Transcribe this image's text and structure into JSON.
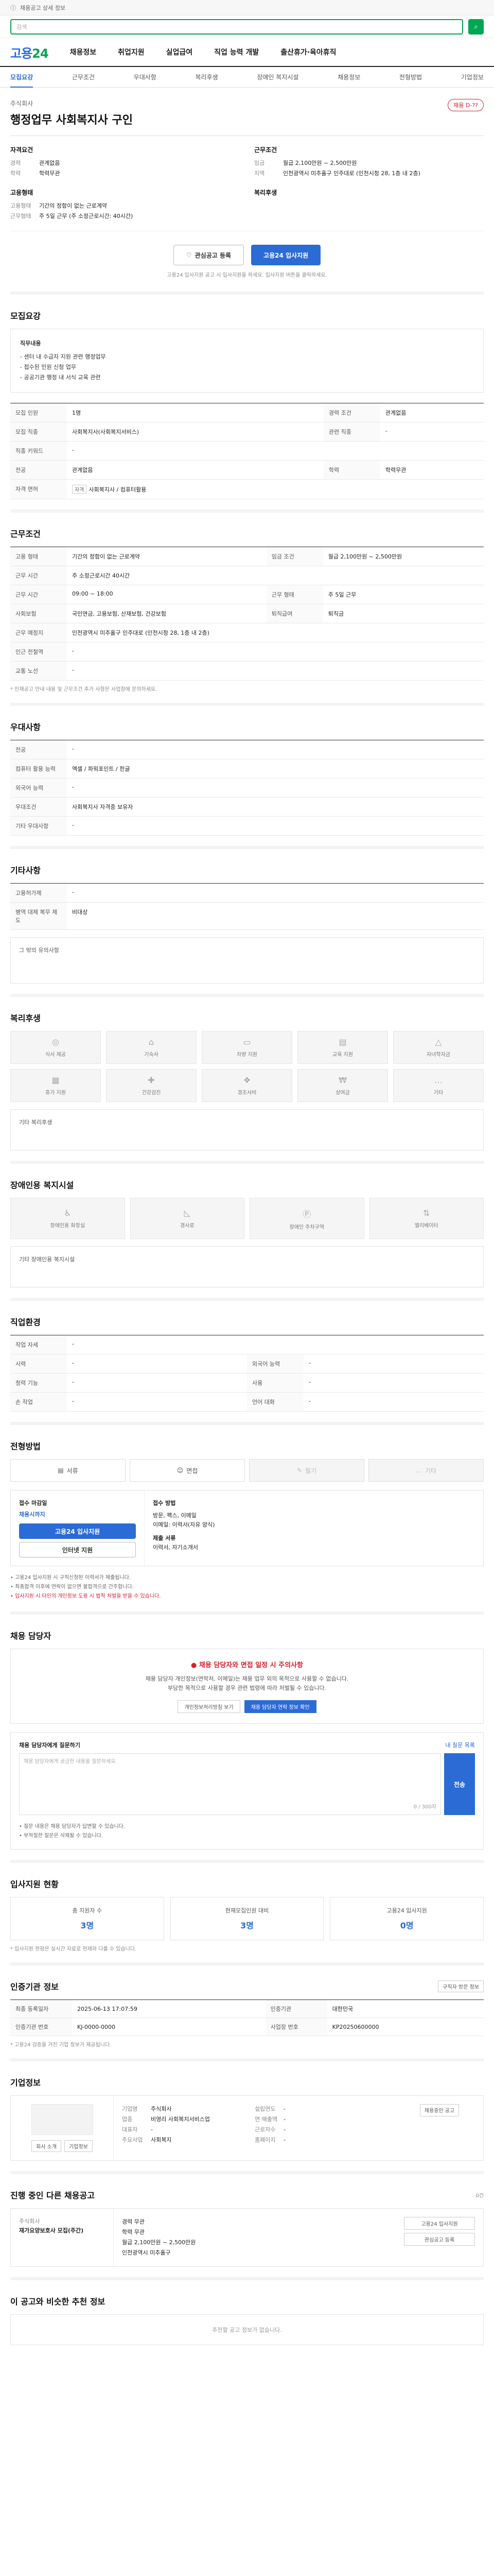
{
  "top": {
    "notice": "채용공고 상세 정보",
    "search_placeholder": "검색"
  },
  "gnb": {
    "logo_a": "고용",
    "logo_b": "24",
    "menu": [
      "채용정보",
      "취업지원",
      "실업급여",
      "직업 능력 개발",
      "출산휴가·육아휴직"
    ]
  },
  "tabs": [
    "모집요강",
    "근무조건",
    "우대사항",
    "복리후생",
    "장애인 복지시설",
    "채용정보",
    "전형방법",
    "기업정보"
  ],
  "head": {
    "company": "주식회사",
    "title": "행정업무 사회복지사 구인",
    "badge": "채용 D-??"
  },
  "summary": {
    "left_title": "자격요건",
    "left": [
      {
        "k": "경력",
        "v": "관계없음"
      },
      {
        "k": "학력",
        "v": "학력무관"
      }
    ],
    "left2_title": "고용형태",
    "left2": [
      {
        "k": "고용형태",
        "v": "기간의 정함이 없는 근로계약"
      },
      {
        "k": "근무형태",
        "v": "주 5일 근무 (주 소정근로시간: 40시간)"
      }
    ],
    "right_title": "근무조건",
    "right": [
      {
        "k": "임금",
        "v": "월급 2,100만원 ~ 2,500만원"
      },
      {
        "k": "지역",
        "v": "인천광역시 미추홀구 인주대로 (인천시청 28, 1층 내 2층)"
      }
    ],
    "right2_title": "복리후생",
    "right2": []
  },
  "actions": {
    "scrap": "관심공고 등록",
    "apply": "고용24 입사지원"
  },
  "note": "고용24 입사지원 공고 시 입사지원을 하세요. 입사지원 버튼을 클릭하세요.",
  "recruit": {
    "title": "모집요강",
    "card_title": "직무내용",
    "card_lines": [
      "- 센터 내 수급자 지원 관련 행정업무",
      "- 접수된 민원 신청 업무",
      "- 공공기관 행정 내 서식 교육 관련"
    ],
    "rows": [
      {
        "k": "모집 인원",
        "v": "1명",
        "k2": "경력 조건",
        "v2": "관계없음"
      },
      {
        "k": "모집 직종",
        "v": "사회복지사(사회복지서비스)",
        "k2": "관련 직종",
        "v2": "-"
      },
      {
        "k": "직종 키워드",
        "v": "-",
        "k2": "",
        "v2": ""
      },
      {
        "k": "전공",
        "v": "관계없음",
        "k2": "학력",
        "v2": "학력무관"
      },
      {
        "k": "자격 면허",
        "v": "사회복지사 / 컴퓨터활용",
        "k2": "",
        "v2": ""
      }
    ]
  },
  "work": {
    "title": "근무조건",
    "rows": [
      {
        "k": "고용 형태",
        "v": "기간의 정함이 없는 근로계약",
        "k2": "임금 조건",
        "v2": "월급 2,100만원 ~ 2,500만원"
      },
      {
        "k": "근무 시간",
        "v": "주 소정근로시간 40시간",
        "k2": "",
        "v2": ""
      },
      {
        "k": "근무 시간",
        "v": "09:00 ~ 18:00",
        "k2": "근무 형태",
        "v2": "주 5일 근무"
      },
      {
        "k": "사회보험",
        "v": "국민연금, 고용보험, 산재보험, 건강보험",
        "k2": "퇴직급여",
        "v2": "퇴직금"
      },
      {
        "k": "근무 예정지",
        "v": "인천광역시 미추홀구 인주대로 (인천시청 28, 1층 내 2층)",
        "k2": "",
        "v2": ""
      },
      {
        "k": "인근 전철역",
        "v": "-",
        "k2": "",
        "v2": ""
      },
      {
        "k": "교통 노선",
        "v": "-",
        "k2": "",
        "v2": ""
      }
    ],
    "note": "* 인재공고 안내 내용 및 근무조건 추가 사항은 사업장에 문의하세요."
  },
  "prefer": {
    "title": "우대사항",
    "rows": [
      {
        "k": "전공",
        "v": "-"
      },
      {
        "k": "컴퓨터 활용 능력",
        "v": "엑셀 / 파워포인트 / 한글"
      },
      {
        "k": "외국어 능력",
        "v": "-"
      },
      {
        "k": "우대조건",
        "v": "사회복지사 자격증 보유자"
      },
      {
        "k": "기타 우대사항",
        "v": "-"
      }
    ]
  },
  "etc": {
    "title": "기타사항",
    "rows": [
      {
        "k": "고용허가제",
        "v": "-"
      },
      {
        "k": "병역 대체 복무 제도",
        "v": "비대상"
      }
    ],
    "box": "그 밖의 유의사항"
  },
  "welfare": {
    "title": "복리후생",
    "tiles": [
      "식사 제공",
      "기숙사",
      "차량 지원",
      "교육 지원",
      "자녀학자금",
      "휴가 지원",
      "건강검진",
      "경조사비",
      "상여금",
      "기타"
    ],
    "box": "기타 복리후생"
  },
  "disab": {
    "title": "장애인용 복지시설",
    "tiles": [
      "장애인용 화장실",
      "경사로",
      "장애인 주차구역",
      "엘리베이터"
    ],
    "box": "기타 장애인용 복지시설"
  },
  "job": {
    "title": "직업환경",
    "rows": [
      {
        "k": "작업 자세",
        "v": "-",
        "k2": "",
        "v2": ""
      },
      {
        "k": "시력",
        "v": "-",
        "k2": "외국어 능력",
        "v2": "-"
      },
      {
        "k": "청력 기능",
        "v": "-",
        "k2": "사용",
        "v2": "-"
      },
      {
        "k": "손 작업",
        "v": "-",
        "k2": "언어 대화",
        "v2": "-"
      }
    ]
  },
  "process": {
    "title": "전형방법",
    "steps": [
      "서류",
      "면접",
      "필기",
      "기타"
    ],
    "left_title": "접수 마감일",
    "left_date": "채용시까지",
    "left_btn": "고용24 입사지원",
    "left_btn2": "인터넷 지원",
    "right_title": "접수 방법",
    "right_lines": [
      "방문, 팩스, 이메일",
      "이메일: 이력서(자유 양식)",
      "제출 서류",
      "이력서, 자기소개서"
    ],
    "bullets": [
      "고용24 입사지원 시 구직신청된 이력서가 제출됩니다.",
      "최종합격 이후에 연락이 없으면 불합격으로 간주합니다.",
      "입사지원 시 타인의 개인정보 도용 시 법적 처벌을 받을 수 있습니다."
    ]
  },
  "manager": {
    "title": "채용 담당자",
    "alert_title": "채용 담당자와 면접 일정 시 주의사항",
    "alert_lines": [
      "채용 담당자 개인정보(연락처, 이메일)는 채용 업무 외의 목적으로 사용할 수 없습니다.",
      "부당한 목적으로 사용할 경우 관련 법령에 따라 처벌될 수 있습니다."
    ],
    "alert_btn1": "개인정보처리방침 보기",
    "alert_btn2": "채용 담당자 연락 정보 확인",
    "q_title": "채용 담당자에게 질문하기",
    "q_right": "내 질문 목록",
    "q_placeholder": "채용 담당자에게 궁금한 내용을 질문하세요.",
    "q_count": "0 / 300자",
    "q_send": "전송",
    "q_bullets": [
      "질문 내용은 채용 담당자가 답변할 수 있습니다.",
      "부적절한 질문은 삭제될 수 있습니다."
    ]
  },
  "status": {
    "title": "입사지원 현황",
    "items": [
      {
        "label": "총 지원자 수",
        "value": "3명"
      },
      {
        "label": "현재모집인원 대비",
        "value": "3명"
      },
      {
        "label": "고용24 입사지원",
        "value": "0명"
      }
    ],
    "note": "* 입사지원 현황은 실시간 자료로 현재와 다를 수 있습니다."
  },
  "reg": {
    "title": "인증기관 정보",
    "btn": "구직자 방문 정보",
    "rows": [
      {
        "k": "최종 등록일자",
        "v": "2025-06-13 17:07:59",
        "k2": "인증기관",
        "v2": "대한민국"
      },
      {
        "k": "인증기관 번호",
        "v": "KJ-0000-0000",
        "k2": "사업장 번호",
        "v2": "KP20250600000"
      }
    ],
    "note": "* 고용24 검증을 거친 기업 정보가 제공됩니다."
  },
  "corp": {
    "title": "기업정보",
    "logo_btn": "회사 소개",
    "logo_btn2": "기업정보",
    "left": [
      {
        "k": "기업명",
        "v": "주식회사"
      },
      {
        "k": "업종",
        "v": "비영리 사회복지서비스업"
      },
      {
        "k": "대표자",
        "v": "-"
      },
      {
        "k": "주요사업",
        "v": "사회복지"
      }
    ],
    "right": [
      {
        "k": "설립연도",
        "v": "-"
      },
      {
        "k": "연 매출액",
        "v": "-"
      },
      {
        "k": "근로자수",
        "v": "-"
      },
      {
        "k": "홈페이지",
        "v": "-"
      }
    ],
    "btn": "채용중인 공고"
  },
  "ongoing": {
    "title": "진행 중인 다른 채용공고",
    "right": "0건",
    "c1": [
      "주식회사",
      "재가요양보호사 모집(주간)"
    ],
    "c2": [
      "경력 무관",
      "학력 무관",
      "월급 2,100만원 ~ 2,500만원",
      "인천광역시 미추홀구"
    ],
    "c3": [
      "고용24 입사지원",
      "관심공고 등록"
    ]
  },
  "recommend": {
    "title": "이 공고와 비슷한 추천 정보",
    "empty": "추천할 공고 정보가 없습니다."
  }
}
